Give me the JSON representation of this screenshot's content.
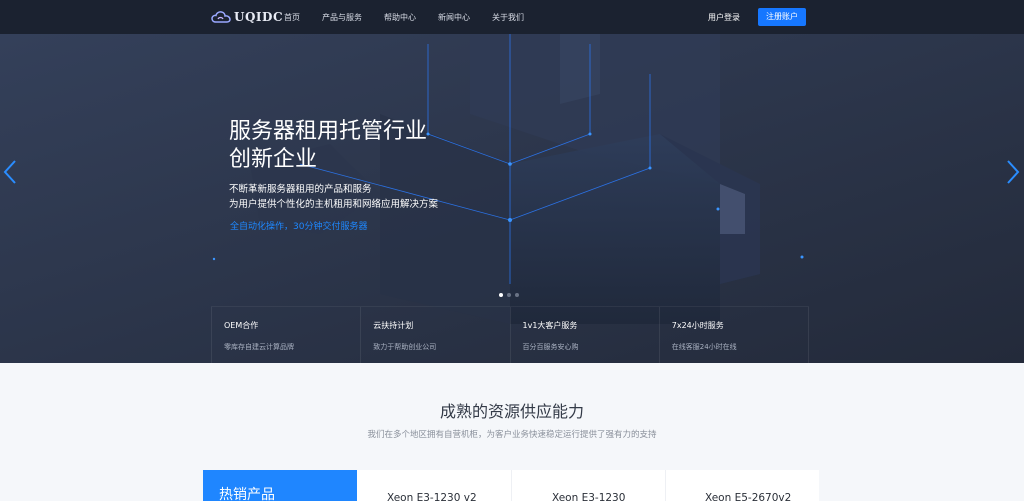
{
  "nav": {
    "logo_text": "UQIDC",
    "menu": [
      "首页",
      "产品与服务",
      "帮助中心",
      "新闻中心",
      "关于我们"
    ],
    "login_label": "用户登录",
    "register_label": "注册账户"
  },
  "hero": {
    "title_line1": "服务器租用托管行业",
    "title_line2": "创新企业",
    "desc_line1": "不断革新服务器租用的产品和服务",
    "desc_line2": "为用户提供个性化的主机租用和网络应用解决方案",
    "highlight": "全自动化操作，30分钟交付服务器",
    "slide_count": 3,
    "active_slide": 1,
    "features": [
      {
        "title": "OEM合作",
        "desc": "零库存自建云计算品牌"
      },
      {
        "title": "云扶持计划",
        "desc": "致力于帮助创业公司"
      },
      {
        "title": "1v1大客户服务",
        "desc": "百分百服务安心购"
      },
      {
        "title": "7x24小时服务",
        "desc": "在线客服24小时在线"
      }
    ]
  },
  "section": {
    "title": "成熟的资源供应能力",
    "subtitle": "我们在多个地区拥有自营机柜，为客户业务快速稳定运行提供了强有力的支持"
  },
  "products": {
    "hot_label": "热销产品",
    "items": [
      "Xeon E3-1230 v2",
      "Xeon E3-1230",
      "Xeon E5-2670v2"
    ]
  },
  "colors": {
    "nav_bg": "#1b2230",
    "hero_bg": "#283042",
    "accent": "#1677ff",
    "highlight": "#1e88ff"
  }
}
